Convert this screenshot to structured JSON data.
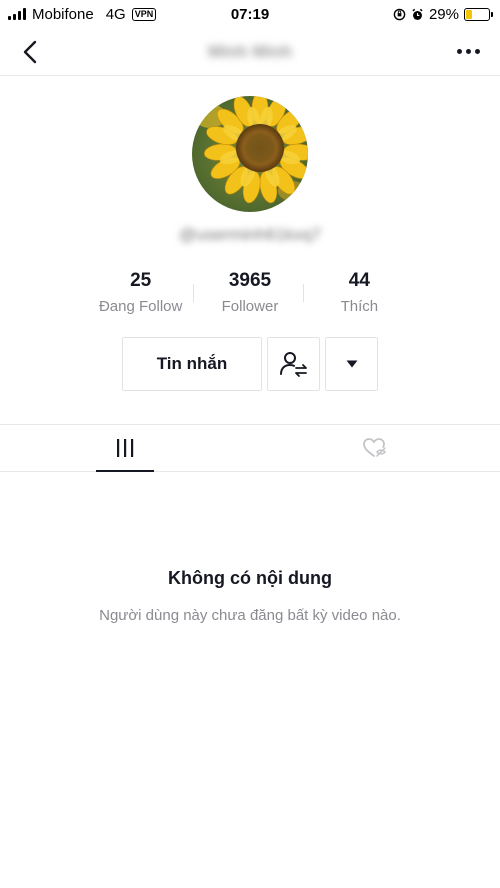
{
  "status_bar": {
    "carrier": "Mobifone",
    "network": "4G",
    "vpn": "VPN",
    "time": "07:19",
    "battery_percent": "29%",
    "battery_level": 0.29,
    "battery_color": "#f5c400"
  },
  "header": {
    "title": "Minh Minh",
    "back_icon": "chevron-left-icon",
    "more_icon": "more-horizontal-icon"
  },
  "profile": {
    "username": "@userminh61kxq7",
    "avatar": "sunflower-image",
    "stats": [
      {
        "value": "25",
        "label": "Đang Follow"
      },
      {
        "value": "3965",
        "label": "Follower"
      },
      {
        "value": "44",
        "label": "Thích"
      }
    ]
  },
  "actions": {
    "message_label": "Tin nhắn",
    "follow_icon": "user-switch-icon",
    "dropdown_icon": "caret-down-icon"
  },
  "tabs": [
    {
      "icon": "videos-grid-icon",
      "active": true
    },
    {
      "icon": "liked-hidden-icon",
      "active": false
    }
  ],
  "empty_state": {
    "title": "Không có nội dung",
    "subtitle": "Người dùng này chưa đăng bất kỳ video nào."
  },
  "colors": {
    "text_primary": "#161823",
    "text_secondary": "#8a8b91",
    "divider": "#e8e8e8"
  }
}
